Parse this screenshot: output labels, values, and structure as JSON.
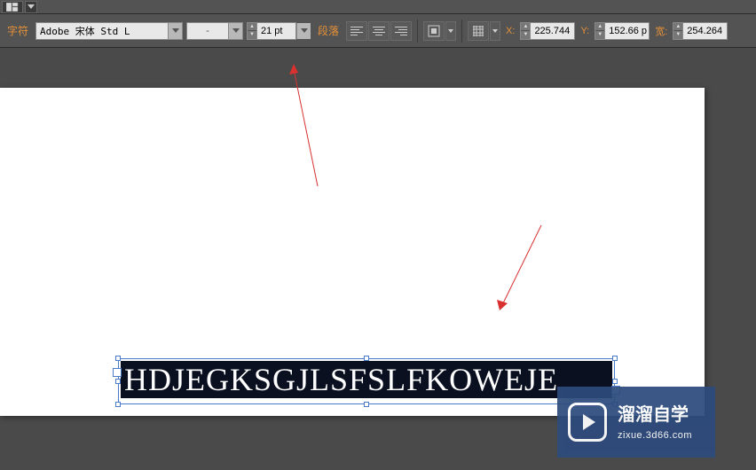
{
  "labels": {
    "char": "字符",
    "paragraph": "段落",
    "x": "X:",
    "y": "Y:",
    "w": "宽:"
  },
  "font": {
    "family": "Adobe 宋体 Std L",
    "style": "-",
    "size": "21 pt"
  },
  "coords": {
    "x": "225.744 ",
    "y": "152.66 p",
    "w": "254.264"
  },
  "canvas": {
    "text": "HDJEGKSGJLSFSLFKOWEJE"
  },
  "watermark": {
    "line1": "溜溜自学",
    "line2": "zixue.3d66.com"
  }
}
